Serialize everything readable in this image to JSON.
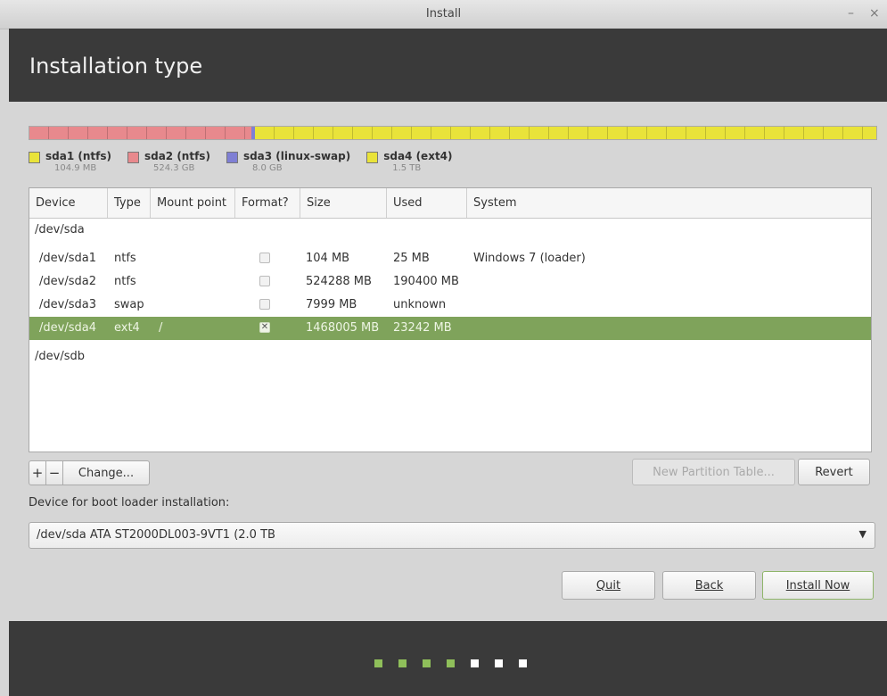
{
  "window": {
    "title": "Install",
    "minimize_icon": "–",
    "close_icon": "×"
  },
  "header": {
    "title": "Installation type"
  },
  "partition_bar": {
    "segments": [
      {
        "name": "sda1",
        "fraction": 0.0001,
        "color": "#e9e33a"
      },
      {
        "name": "sda2",
        "fraction": 0.2621,
        "color": "#e8898d"
      },
      {
        "name": "sda3",
        "fraction": 0.004,
        "color": "#7f7fd4"
      },
      {
        "name": "sda4",
        "fraction": 0.7338,
        "color": "#e9e33a"
      }
    ]
  },
  "legend": [
    {
      "label": "sda1 (ntfs)",
      "size": "104.9 MB",
      "color": "#e9e33a"
    },
    {
      "label": "sda2 (ntfs)",
      "size": "524.3 GB",
      "color": "#e8898d"
    },
    {
      "label": "sda3 (linux-swap)",
      "size": "8.0 GB",
      "color": "#7f7fd4"
    },
    {
      "label": "sda4 (ext4)",
      "size": "1.5 TB",
      "color": "#e9e33a"
    }
  ],
  "table": {
    "headers": [
      "Device",
      "Type",
      "Mount point",
      "Format?",
      "Size",
      "Used",
      "System"
    ],
    "rows": [
      {
        "device": "/dev/sda",
        "type": "",
        "mount": "",
        "format": null,
        "size": "",
        "used": "",
        "system": "",
        "selected": false,
        "indent": false
      },
      {
        "device": "/dev/sda1",
        "type": "ntfs",
        "mount": "",
        "format": false,
        "size": "104 MB",
        "used": "25 MB",
        "system": "Windows 7 (loader)",
        "selected": false,
        "indent": true
      },
      {
        "device": "/dev/sda2",
        "type": "ntfs",
        "mount": "",
        "format": false,
        "size": "524288 MB",
        "used": "190400 MB",
        "system": "",
        "selected": false,
        "indent": true
      },
      {
        "device": "/dev/sda3",
        "type": "swap",
        "mount": "",
        "format": false,
        "size": "7999 MB",
        "used": "unknown",
        "system": "",
        "selected": false,
        "indent": true
      },
      {
        "device": "/dev/sda4",
        "type": "ext4",
        "mount": "/",
        "format": true,
        "size": "1468005 MB",
        "used": "23242 MB",
        "system": "",
        "selected": true,
        "indent": true
      },
      {
        "device": "/dev/sdb",
        "type": "",
        "mount": "",
        "format": null,
        "size": "",
        "used": "",
        "system": "",
        "selected": false,
        "indent": false
      }
    ]
  },
  "toolbar": {
    "add_label": "+",
    "remove_label": "−",
    "change_label": "Change...",
    "new_table_label": "New Partition Table...",
    "revert_label": "Revert"
  },
  "bootloader": {
    "label": "Device for boot loader installation:",
    "value": "/dev/sda   ATA ST2000DL003-9VT1 (2.0 TB",
    "arrow_icon": "▼"
  },
  "actions": {
    "quit_label": "Quit",
    "back_label": "Back",
    "install_label": "Install Now"
  },
  "progress": {
    "total_steps": 7,
    "completed_steps": 4,
    "done_color": "#8fbf5a",
    "todo_color": "#ffffff"
  }
}
